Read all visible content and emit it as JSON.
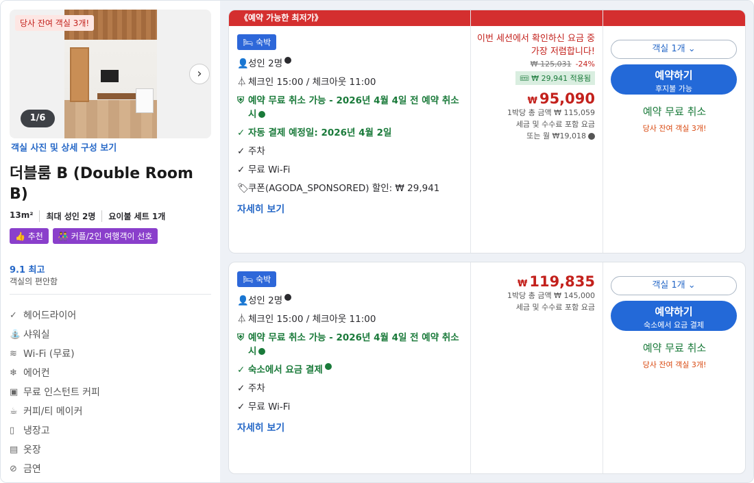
{
  "left": {
    "photo_badge": "당사 잔여 객실 3개!",
    "photo_counter": "1/6",
    "next_icon": "chevron-right-icon",
    "photo_link": "객실 사진 및 상세 구성 보기",
    "room_name": "더블룸 B (Double Room B)",
    "specs": [
      "13m²",
      "최대 성인 2명",
      "요이불 세트 1개"
    ],
    "tags": [
      "추천",
      "커플/2인 여행객이 선호"
    ],
    "score": "9.1 최고",
    "score_sub": "객실의 편안함",
    "amenities": [
      {
        "icon": "check-icon",
        "label": "헤어드라이어"
      },
      {
        "icon": "shower-icon",
        "label": "샤워실"
      },
      {
        "icon": "wifi-icon",
        "label": "Wi-Fi (무료)"
      },
      {
        "icon": "air-conditioner-icon",
        "label": "에어컨"
      },
      {
        "icon": "coffee-machine-icon",
        "label": "무료 인스턴트 커피"
      },
      {
        "icon": "kettle-icon",
        "label": "커피/티 메이커"
      },
      {
        "icon": "fridge-icon",
        "label": "냉장고"
      },
      {
        "icon": "wardrobe-icon",
        "label": "옷장"
      },
      {
        "icon": "no-smoking-icon",
        "label": "금연"
      }
    ]
  },
  "ribbon": "《예약 가능한 최저가》",
  "offers": [
    {
      "stay_tag": "숙박",
      "guests": "성인 2명",
      "checkin": "체크인 15:00 / 체크아웃 11:00",
      "cancel": "예약 무료 취소 가능 - 2026년 4월 4일 전 예약 취소 시",
      "payment": "자동 결제 예정일: 2026년 4월 2일",
      "parking": "주차",
      "wifi": "무료 Wi-Fi",
      "coupon": "쿠폰(AGODA_SPONSORED) 할인: ₩ 29,941",
      "more": "자세히 보기",
      "promo": "이번 세션에서 확인하신 요금 중 가장 저렴합니다!",
      "old_price": "₩ 125,031",
      "discount": "-24%",
      "applied": "₩ 29,941 적용됨",
      "currency": "₩",
      "price": "95,090",
      "total": "1박당 총 금액 ₩ 115,059",
      "tax": "세금 및 수수료 포함 요금",
      "monthly": "또는 월 ₩19,018",
      "select": "객실 1개",
      "book": "예약하기",
      "book_sub": "후지불 가능",
      "free_cancel": "예약 무료 취소",
      "rooms_left": "당사 잔여 객실 3개!"
    },
    {
      "stay_tag": "숙박",
      "guests": "성인 2명",
      "checkin": "체크인 15:00 / 체크아웃 11:00",
      "cancel": "예약 무료 취소 가능 - 2026년 4월 4일 전 예약 취소 시",
      "payment": "숙소에서 요금 결제",
      "parking": "주차",
      "wifi": "무료 Wi-Fi",
      "more": "자세히 보기",
      "currency": "₩",
      "price": "119,835",
      "total": "1박당 총 금액 ₩ 145,000",
      "tax": "세금 및 수수료 포함 요금",
      "select": "객실 1개",
      "book": "예약하기",
      "book_sub": "숙소에서 요금 결제",
      "free_cancel": "예약 무료 취소",
      "rooms_left": "당사 잔여 객실 3개!"
    }
  ]
}
